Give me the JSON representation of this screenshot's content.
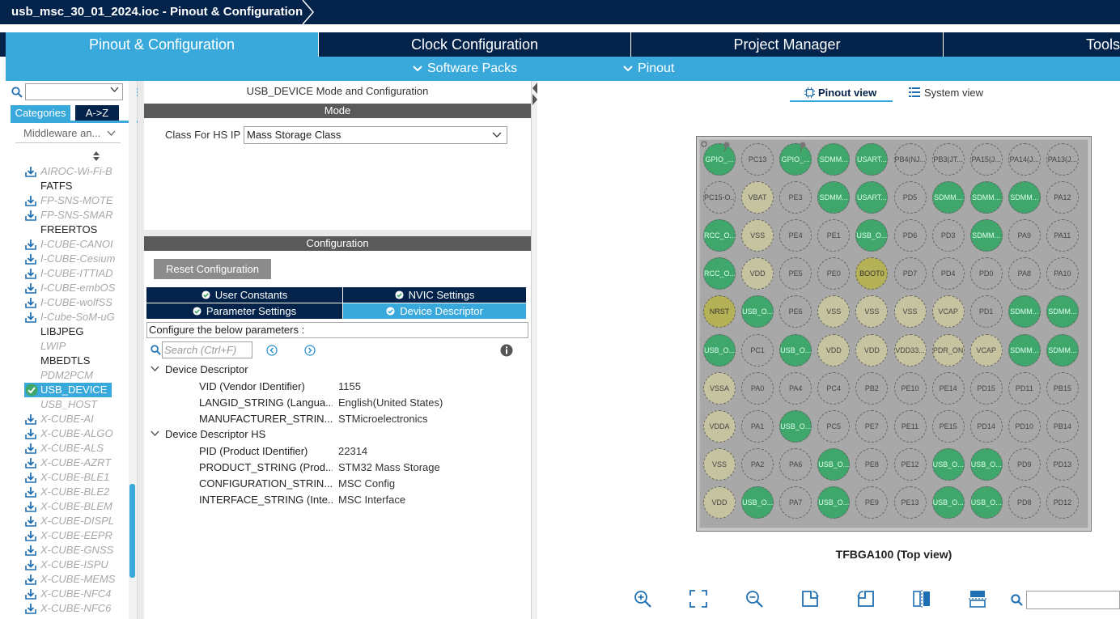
{
  "title": "usb_msc_30_01_2024.ioc - Pinout & Configuration",
  "colors": {
    "navy": "#03234b",
    "accent": "#39a9dc",
    "pin_green": "#3fa76b",
    "pin_gray": "#a8a8a8",
    "pin_beige": "#c6c3a0",
    "pin_olive": "#b5b156"
  },
  "main_tabs": [
    "Pinout & Configuration",
    "Clock Configuration",
    "Project Manager",
    "Tools"
  ],
  "sub_menu": [
    "Software Packs",
    "Pinout"
  ],
  "sidebar": {
    "search_value": "",
    "cat_tabs": [
      "Categories",
      "A->Z"
    ],
    "middleware_select": "Middleware an...",
    "items": [
      {
        "label": "AIROC-Wi-Fi-B",
        "style": "gray",
        "icon": "download-icon"
      },
      {
        "label": "FATFS",
        "style": "black",
        "icon": ""
      },
      {
        "label": "FP-SNS-MOTE",
        "style": "gray",
        "icon": "download-icon"
      },
      {
        "label": "FP-SNS-SMAR",
        "style": "gray",
        "icon": "download-icon"
      },
      {
        "label": "FREERTOS",
        "style": "black",
        "icon": ""
      },
      {
        "label": "I-CUBE-CANOI",
        "style": "gray",
        "icon": "download-icon"
      },
      {
        "label": "I-CUBE-Cesium",
        "style": "gray",
        "icon": "download-icon"
      },
      {
        "label": "I-CUBE-ITTIAD",
        "style": "gray",
        "icon": "download-icon"
      },
      {
        "label": "I-CUBE-embOS",
        "style": "gray",
        "icon": "download-icon"
      },
      {
        "label": "I-CUBE-wolfSS",
        "style": "gray",
        "icon": "download-icon"
      },
      {
        "label": "I-Cube-SoM-uG",
        "style": "gray",
        "icon": "download-icon"
      },
      {
        "label": "LIBJPEG",
        "style": "black",
        "icon": ""
      },
      {
        "label": "LWIP",
        "style": "gray",
        "icon": ""
      },
      {
        "label": "MBEDTLS",
        "style": "black",
        "icon": ""
      },
      {
        "label": "PDM2PCM",
        "style": "gray",
        "icon": ""
      },
      {
        "label": "USB_DEVICE",
        "style": "selected",
        "icon": "check-circle-icon"
      },
      {
        "label": "USB_HOST",
        "style": "gray",
        "icon": ""
      },
      {
        "label": "X-CUBE-AI",
        "style": "gray",
        "icon": "download-icon"
      },
      {
        "label": "X-CUBE-ALGO",
        "style": "gray",
        "icon": "download-icon"
      },
      {
        "label": "X-CUBE-ALS",
        "style": "gray",
        "icon": "download-icon"
      },
      {
        "label": "X-CUBE-AZRT",
        "style": "gray",
        "icon": "download-icon"
      },
      {
        "label": "X-CUBE-BLE1",
        "style": "gray",
        "icon": "download-icon"
      },
      {
        "label": "X-CUBE-BLE2",
        "style": "gray",
        "icon": "download-icon"
      },
      {
        "label": "X-CUBE-BLEM",
        "style": "gray",
        "icon": "download-icon"
      },
      {
        "label": "X-CUBE-DISPL",
        "style": "gray",
        "icon": "download-icon"
      },
      {
        "label": "X-CUBE-EEPR",
        "style": "gray",
        "icon": "download-icon"
      },
      {
        "label": "X-CUBE-GNSS",
        "style": "gray",
        "icon": "download-icon"
      },
      {
        "label": "X-CUBE-ISPU",
        "style": "gray",
        "icon": "download-icon"
      },
      {
        "label": "X-CUBE-MEMS",
        "style": "gray",
        "icon": "download-icon"
      },
      {
        "label": "X-CUBE-NFC4",
        "style": "gray",
        "icon": "download-icon"
      },
      {
        "label": "X-CUBE-NFC6",
        "style": "gray",
        "icon": "download-icon"
      }
    ]
  },
  "middle": {
    "title": "USB_DEVICE Mode and Configuration",
    "mode_header": "Mode",
    "class_label": "Class For HS IP",
    "class_value": "Mass Storage Class",
    "config_header": "Configuration",
    "reset_label": "Reset Configuration",
    "tabs": [
      "User Constants",
      "NVIC Settings",
      "Parameter Settings",
      "Device Descriptor"
    ],
    "configure_text": "Configure the below parameters :",
    "search_placeholder": "Search (Ctrl+F)",
    "groups": [
      {
        "name": "Device Descriptor",
        "params": [
          {
            "name": "VID (Vendor IDentifier)",
            "value": "1155"
          },
          {
            "name": "LANGID_STRING (Langua...",
            "value": "English(United States)"
          },
          {
            "name": "MANUFACTURER_STRIN...",
            "value": "STMicroelectronics"
          }
        ]
      },
      {
        "name": "Device Descriptor HS",
        "params": [
          {
            "name": "PID (Product IDentifier)",
            "value": "22314"
          },
          {
            "name": "PRODUCT_STRING (Prod...",
            "value": "STM32 Mass Storage"
          },
          {
            "name": "CONFIGURATION_STRIN...",
            "value": "MSC Config"
          },
          {
            "name": "INTERFACE_STRING (Inte...",
            "value": "MSC Interface"
          }
        ]
      }
    ]
  },
  "right": {
    "view_tabs": [
      "Pinout view",
      "System view"
    ],
    "package_label": "TFBGA100 (Top view)",
    "zoom_value": "",
    "pins": [
      [
        [
          "GPIO_...",
          "green"
        ],
        [
          "PC13",
          "g"
        ],
        [
          "GPIO_...",
          "green"
        ],
        [
          "SDMM...",
          "green"
        ],
        [
          "USART...",
          "green"
        ],
        [
          "PB4(NJ...",
          "g"
        ],
        [
          "PB3(JT...",
          "g"
        ],
        [
          "PA15(J...",
          "g"
        ],
        [
          "PA14(J...",
          "g"
        ],
        [
          "PA13(J...",
          "g"
        ]
      ],
      [
        [
          "PC15-O...",
          "g"
        ],
        [
          "VBAT",
          "beige"
        ],
        [
          "PE3",
          "g"
        ],
        [
          "SDMM...",
          "green"
        ],
        [
          "USART...",
          "green"
        ],
        [
          "PD5",
          "g"
        ],
        [
          "SDMM...",
          "green"
        ],
        [
          "SDMM...",
          "green"
        ],
        [
          "SDMM...",
          "green"
        ],
        [
          "PA12",
          "g"
        ]
      ],
      [
        [
          "RCC_O...",
          "green"
        ],
        [
          "VSS",
          "beige"
        ],
        [
          "PE4",
          "g"
        ],
        [
          "PE1",
          "g"
        ],
        [
          "USB_O...",
          "green"
        ],
        [
          "PD6",
          "g"
        ],
        [
          "PD3",
          "g"
        ],
        [
          "SDMM...",
          "green"
        ],
        [
          "PA9",
          "g"
        ],
        [
          "PA11",
          "g"
        ]
      ],
      [
        [
          "RCC_O...",
          "green"
        ],
        [
          "VDD",
          "beige"
        ],
        [
          "PE5",
          "g"
        ],
        [
          "PE0",
          "g"
        ],
        [
          "BOOT0",
          "olive"
        ],
        [
          "PD7",
          "g"
        ],
        [
          "PD4",
          "g"
        ],
        [
          "PD0",
          "g"
        ],
        [
          "PA8",
          "g"
        ],
        [
          "PA10",
          "g"
        ]
      ],
      [
        [
          "NRST",
          "olive"
        ],
        [
          "USB_O...",
          "green"
        ],
        [
          "PE6",
          "g"
        ],
        [
          "VSS",
          "beige"
        ],
        [
          "VSS",
          "beige"
        ],
        [
          "VSS",
          "beige"
        ],
        [
          "VCAP",
          "beige"
        ],
        [
          "PD1",
          "g"
        ],
        [
          "SDMM...",
          "green"
        ],
        [
          "SDMM...",
          "green"
        ]
      ],
      [
        [
          "USB_O...",
          "green"
        ],
        [
          "PC1",
          "g"
        ],
        [
          "USB_O...",
          "green"
        ],
        [
          "VDD",
          "beige"
        ],
        [
          "VDD",
          "beige"
        ],
        [
          "VDD33...",
          "beige"
        ],
        [
          "PDR_ON",
          "beige"
        ],
        [
          "VCAP",
          "beige"
        ],
        [
          "SDMM...",
          "green"
        ],
        [
          "SDMM...",
          "green"
        ]
      ],
      [
        [
          "VSSA",
          "beige"
        ],
        [
          "PA0",
          "g"
        ],
        [
          "PA4",
          "g"
        ],
        [
          "PC4",
          "g"
        ],
        [
          "PB2",
          "g"
        ],
        [
          "PE10",
          "g"
        ],
        [
          "PE14",
          "g"
        ],
        [
          "PD15",
          "g"
        ],
        [
          "PD11",
          "g"
        ],
        [
          "PB15",
          "g"
        ]
      ],
      [
        [
          "VDDA",
          "beige"
        ],
        [
          "PA1",
          "g"
        ],
        [
          "USB_O...",
          "green"
        ],
        [
          "PC5",
          "g"
        ],
        [
          "PE7",
          "g"
        ],
        [
          "PE11",
          "g"
        ],
        [
          "PE15",
          "g"
        ],
        [
          "PD14",
          "g"
        ],
        [
          "PD10",
          "g"
        ],
        [
          "PB14",
          "g"
        ]
      ],
      [
        [
          "VSS",
          "beige"
        ],
        [
          "PA2",
          "g"
        ],
        [
          "PA6",
          "g"
        ],
        [
          "USB_O...",
          "green"
        ],
        [
          "PE8",
          "g"
        ],
        [
          "PE12",
          "g"
        ],
        [
          "USB_O...",
          "green"
        ],
        [
          "USB_O...",
          "green"
        ],
        [
          "PD9",
          "g"
        ],
        [
          "PD13",
          "g"
        ]
      ],
      [
        [
          "VDD",
          "beige"
        ],
        [
          "USB_O...",
          "green"
        ],
        [
          "PA7",
          "g"
        ],
        [
          "USB_O...",
          "green"
        ],
        [
          "PE9",
          "g"
        ],
        [
          "PE13",
          "g"
        ],
        [
          "USB_O...",
          "green"
        ],
        [
          "USB_O...",
          "green"
        ],
        [
          "PD8",
          "g"
        ],
        [
          "PD12",
          "g"
        ]
      ]
    ]
  }
}
